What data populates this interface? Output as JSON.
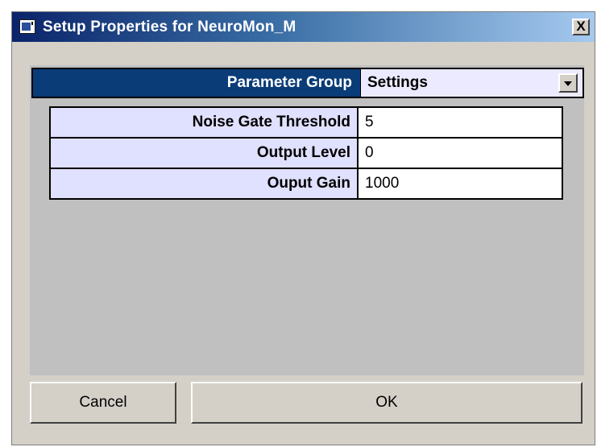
{
  "window": {
    "title": "Setup Properties for NeuroMon_M",
    "close_label": "X"
  },
  "parameter_group": {
    "label": "Parameter Group",
    "selected": "Settings"
  },
  "parameters": [
    {
      "label": "Noise Gate Threshold",
      "value": "5"
    },
    {
      "label": "Output Level",
      "value": "0"
    },
    {
      "label": "Ouput Gain",
      "value": "1000"
    }
  ],
  "buttons": {
    "cancel": "Cancel",
    "ok": "OK"
  },
  "colors": {
    "title_gradient_start": "#0a246a",
    "group_header_bg": "#0a3c77",
    "param_label_bg": "#e0e0ff",
    "panel_bg": "#c0c0c0",
    "dialog_bg": "#d4d0c8"
  },
  "icons": {
    "app": "window-app-icon",
    "close": "close-icon",
    "dropdown": "chevron-down-icon"
  }
}
